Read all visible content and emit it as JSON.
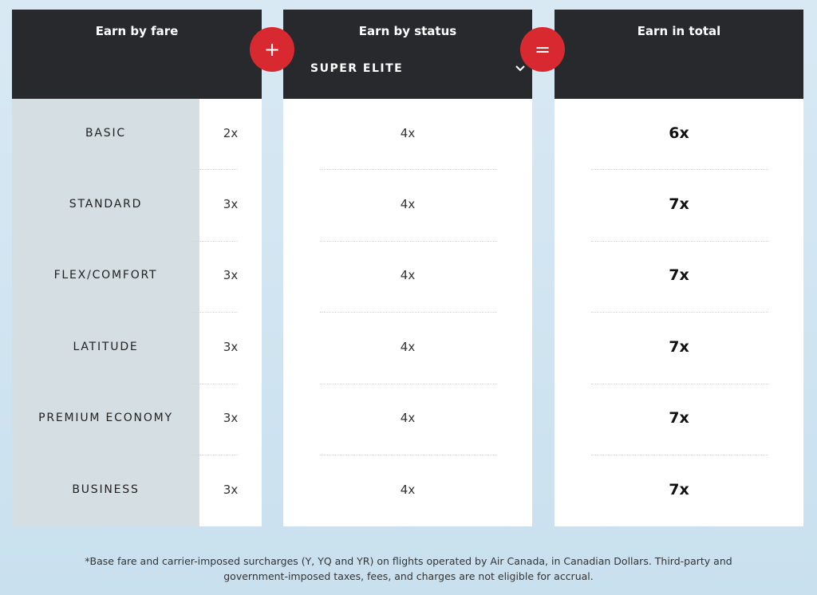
{
  "columns": {
    "fare": {
      "title": "Earn by fare"
    },
    "status": {
      "title": "Earn by status",
      "selected_status": "SUPER ELITE",
      "dropdown_icon": "chevron-down-icon"
    },
    "total": {
      "title": "Earn in total"
    }
  },
  "operators": {
    "plus": "+",
    "equals": "="
  },
  "rows": [
    {
      "fare": "BASIC",
      "fare_rate": "2x",
      "status_rate": "4x",
      "total": "6x"
    },
    {
      "fare": "STANDARD",
      "fare_rate": "3x",
      "status_rate": "4x",
      "total": "7x"
    },
    {
      "fare": "FLEX/COMFORT",
      "fare_rate": "3x",
      "status_rate": "4x",
      "total": "7x"
    },
    {
      "fare": "LATITUDE",
      "fare_rate": "3x",
      "status_rate": "4x",
      "total": "7x"
    },
    {
      "fare": "PREMIUM ECONOMY",
      "fare_rate": "3x",
      "status_rate": "4x",
      "total": "7x"
    },
    {
      "fare": "BUSINESS",
      "fare_rate": "3x",
      "status_rate": "4x",
      "total": "7x"
    }
  ],
  "footnote": "*Base fare and carrier-imposed surcharges (Y, YQ and YR) on flights operated by Air Canada, in Canadian Dollars. Third-party and government-imposed taxes, fees, and charges are not eligible for accrual.",
  "colors": {
    "accent": "#d7292f",
    "header_bg": "#27292c",
    "fare_label_bg": "#d5dee3"
  }
}
